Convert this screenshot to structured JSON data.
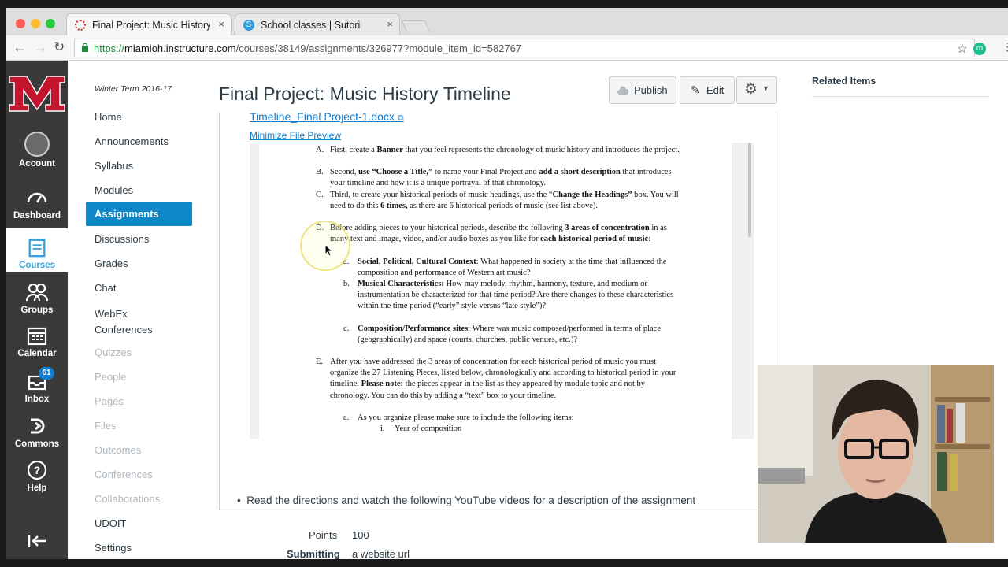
{
  "browser": {
    "tabs": [
      {
        "title": "Final Project: Music History Ti",
        "close": "×"
      },
      {
        "title": "School classes | Sutori",
        "close": "×"
      }
    ],
    "url_scheme": "https://",
    "url_host": "miamioh.instructure.com",
    "url_path": "/courses/38149/assignments/326977?module_item_id=582767",
    "ext_label": "m"
  },
  "global_nav": {
    "account": "Account",
    "dashboard": "Dashboard",
    "courses": "Courses",
    "groups": "Groups",
    "calendar": "Calendar",
    "inbox": "Inbox",
    "inbox_badge": "61",
    "commons": "Commons",
    "help": "Help"
  },
  "course_nav": {
    "term": "Winter Term 2016-17",
    "items": [
      "Home",
      "Announcements",
      "Syllabus",
      "Modules"
    ],
    "active": "Assignments",
    "items_after": [
      "Discussions",
      "Grades",
      "Chat",
      "WebEx",
      "Conferences"
    ],
    "disabled": [
      "Quizzes",
      "People",
      "Pages",
      "Files",
      "Outcomes",
      "Conferences",
      "Collaborations"
    ],
    "bottom": [
      "UDOIT",
      "Settings"
    ]
  },
  "page": {
    "title": "Final Project: Music History Timeline",
    "publish": "Publish",
    "edit": "Edit",
    "related": "Related Items",
    "file_link": "Timeline_Final Project-1.docx",
    "minimize": "Minimize File Preview",
    "bullet": "Read the directions and watch the following YouTube videos for a description of the assignment",
    "points_label": "Points",
    "points_value": "100",
    "submitting_label": "Submitting",
    "submitting_value": "a website url"
  },
  "doc": {
    "A_label": "A.",
    "A_text_pre": "First, create a ",
    "A_bold": "Banner",
    "A_text_post": " that you feel represents the chronology of music history and introduces the project.",
    "B_label": "B.",
    "B_text_pre": "Second, ",
    "B_bold1": "use “Choose a Title,”",
    "B_text_mid": " to name your Final Project and ",
    "B_bold2": "add a short description",
    "B_text_post": " that introduces your timeline and how it is a unique portrayal of that chronology.",
    "C_label": "C.",
    "C_text_pre": "Third, to create your historical periods of music headings, use the “",
    "C_bold1": "Change the Headings”",
    "C_text_mid": " box. You will need to do this ",
    "C_bold2": "6 times,",
    "C_text_post": " as there are 6 historical periods of music (see list above).",
    "D_label": "D.",
    "D_text_pre": "Before adding pieces to your historical periods, describe the following ",
    "D_bold1": "3 areas of concentration",
    "D_text_mid": " in as many text and image, video, and/or audio boxes as you like for ",
    "D_bold2": "each historical period of music",
    "D_text_post": ":",
    "Da_label": "a.",
    "Da_bold": "Social, Political, Cultural Context",
    "Da_text": ": What happened in society at the time that influenced the composition and performance of Western art music?",
    "Db_label": "b.",
    "Db_bold": "Musical Characteristics:",
    "Db_text": " How may melody, rhythm, harmony, texture, and medium or instrumentation be characterized for that time period? Are there changes to these characteristics within the time period (“early” style versus “late style”)?",
    "Dc_label": "c.",
    "Dc_bold": "Composition/Performance sites",
    "Dc_text": ": Where was music composed/performed in terms of place (geographically) and space (courts, churches, public venues, etc.)?",
    "E_label": "E.",
    "E_text_pre": "After you have addressed the 3 areas of concentration for each historical period of music you must organize the 27 Listening Pieces, listed below, chronologically and according to historical period in your timeline. ",
    "E_bold": "Please note:",
    "E_text_post": " the pieces appear in the list as they appeared by module topic and not by chronology. You can do this by adding a “text” box to your timeline.",
    "Ea_label": "a.",
    "Ea_text": "As you organize please make sure to include the following items:",
    "Eai_label": "i.",
    "Eai_text": "Year of composition"
  }
}
